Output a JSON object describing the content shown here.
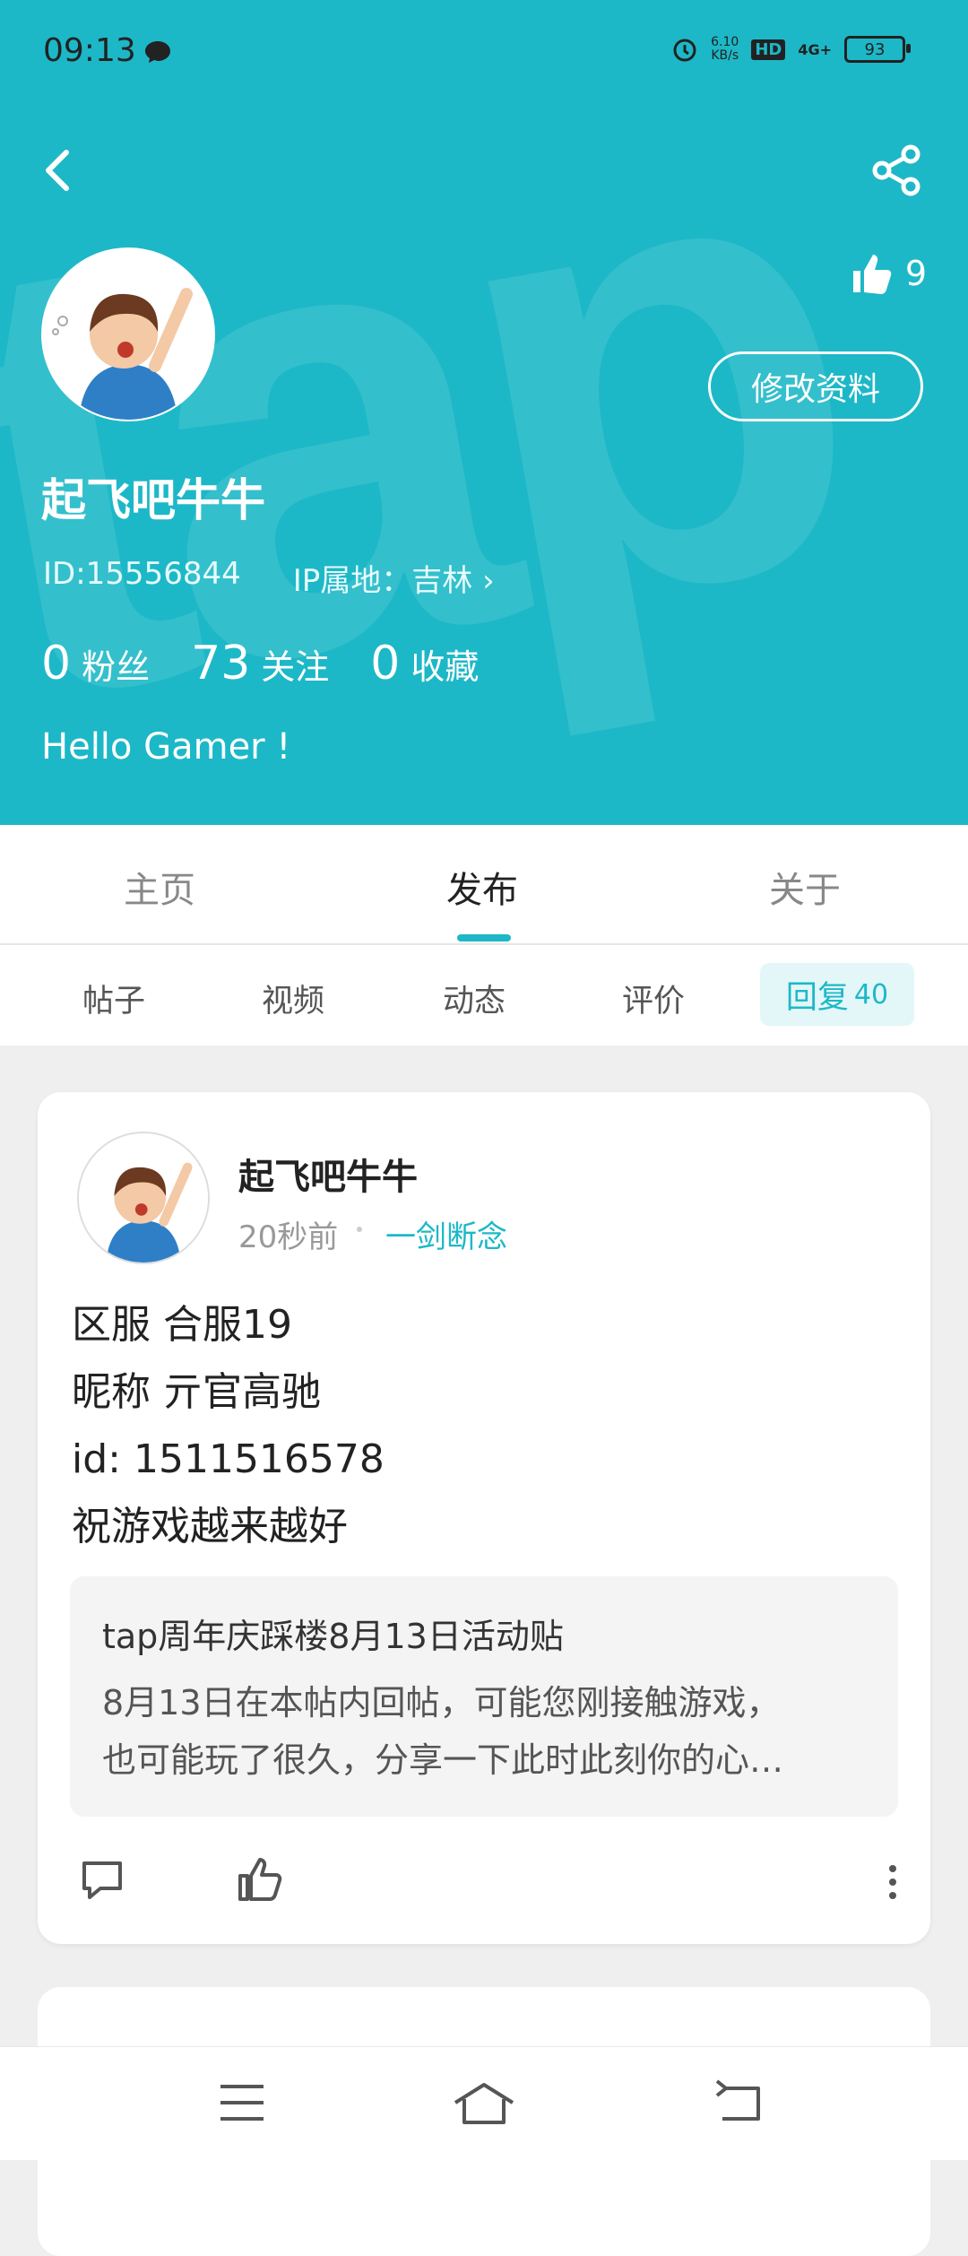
{
  "status_bar": {
    "time": "09:13",
    "net_speed_value": "6.10",
    "net_speed_unit": "KB/s",
    "hd": "HD",
    "signal": "4G+",
    "battery": "93"
  },
  "header": {
    "like_count": "9",
    "edit_label": "修改资料",
    "username": "起飞吧牛牛",
    "id_text": "ID:15556844",
    "ip_text": "IP属地：吉林",
    "stats": [
      {
        "value": "0",
        "label": "粉丝"
      },
      {
        "value": "73",
        "label": "关注"
      },
      {
        "value": "0",
        "label": "收藏"
      }
    ],
    "bio": "Hello Gamer !",
    "accent_color": "#1db8c7"
  },
  "tabs": [
    "主页",
    "发布",
    "关于"
  ],
  "subtabs": [
    "帖子",
    "视频",
    "动态",
    "评价"
  ],
  "active_subtab": {
    "label": "回复",
    "count": "40"
  },
  "post": {
    "author": "起飞吧牛牛",
    "time": "20秒前",
    "game": "一剑断念",
    "body_lines": [
      "区服 合服19",
      "昵称 亓官高驰",
      "id: 1511516578",
      "祝游戏越来越好"
    ],
    "quote_title": "tap周年庆踩楼8月13日活动贴",
    "quote_body_lines": [
      "8月13日在本帖内回帖，可能您刚接触游戏，",
      "也可能玩了很久，分享一下此时此刻你的心…"
    ]
  }
}
